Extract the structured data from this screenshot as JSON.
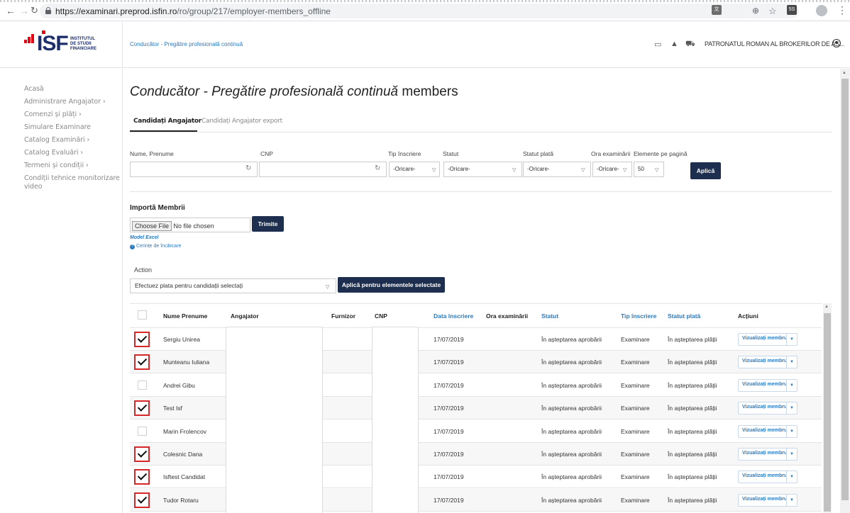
{
  "browser": {
    "url_host": "https://examinari.preprod.isfin.ro",
    "url_path": "/ro/group/217/employer-members_offline"
  },
  "logo": {
    "mark": "ISF",
    "line1": "INSTITUTUL",
    "line2": "DE STUDII",
    "line3": "FINANCIARE"
  },
  "header": {
    "breadcrumb": "Conducător - Pregătire profesională continuă",
    "user": "PATRONATUL ROMAN AL BROKERILOR DE AS..."
  },
  "sidebar": {
    "items": [
      {
        "label": "Acasă"
      },
      {
        "label": "Administrare Angajator ›"
      },
      {
        "label": "Comenzi și plăți ›"
      },
      {
        "label": "Simulare Examinare"
      },
      {
        "label": "Catalog Examinări ›"
      },
      {
        "label": "Catalog Evaluări ›"
      },
      {
        "label": "Termeni și condiții ›"
      },
      {
        "label": "Condiții tehnice monitorizare"
      },
      {
        "label": "video"
      }
    ]
  },
  "main": {
    "title_italic": "Conducător - Pregătire profesională continuă",
    "title_plain": " members",
    "tabs": [
      {
        "label": "Candidați Angajator"
      },
      {
        "label": "Candidați Angajator export"
      }
    ]
  },
  "filters": {
    "labels": {
      "name": "Nume, Prenume",
      "cnp": "CNP",
      "tip": "Tip înscriere",
      "statut": "Statut",
      "statut_plata": "Statut plată",
      "ora": "Ora examinării",
      "elemente": "Elemente pe pagină"
    },
    "values": {
      "name": "",
      "cnp": "",
      "tip": "-Oricare-",
      "statut": "-Oricare-",
      "statut_plata": "-Oricare-",
      "ora": "-Oricare-",
      "elemente": "50"
    },
    "apply_label": "Aplică"
  },
  "import": {
    "title": "Importă Membrii",
    "choose_label": "Choose File",
    "file_status": "No file chosen",
    "submit_label": "Trimite",
    "model_link": "Model Excel",
    "requirements_link": "Cerințe de încărcare"
  },
  "action": {
    "label": "Action",
    "selected": "Efectuez plata pentru candidații selectați",
    "apply_label": "Aplică pentru elementele selectate"
  },
  "table": {
    "headers": {
      "nume": "Nume Prenume",
      "angajator": "Angajator",
      "furnizor": "Furnizor",
      "cnp": "CNP",
      "data": "Data înscriere",
      "ora": "Ora examinării",
      "statut": "Statut",
      "tip": "Tip înscriere",
      "statut_plata": "Statut plată",
      "actiuni": "Acțiuni"
    },
    "view_button_label": "Vizualizați membru",
    "rows": [
      {
        "checked": true,
        "name": "Sergiu Unirea",
        "date": "17/07/2019",
        "status": "În așteptarea aprobării",
        "type": "Examinare",
        "payment": "În așteptarea plății"
      },
      {
        "checked": true,
        "name": "Munteanu Iuliana",
        "date": "17/07/2019",
        "status": "În așteptarea aprobării",
        "type": "Examinare",
        "payment": "În așteptarea plății"
      },
      {
        "checked": false,
        "name": "Andrei Gibu",
        "date": "17/07/2019",
        "status": "În așteptarea aprobării",
        "type": "Examinare",
        "payment": "În așteptarea plății"
      },
      {
        "checked": true,
        "name": "Test Isf",
        "date": "17/07/2019",
        "status": "În așteptarea aprobării",
        "type": "Examinare",
        "payment": "În așteptarea plății"
      },
      {
        "checked": false,
        "name": "Marin Frolencov",
        "date": "17/07/2019",
        "status": "În așteptarea aprobării",
        "type": "Examinare",
        "payment": "În așteptarea plății"
      },
      {
        "checked": true,
        "name": "Colesnic Dana",
        "date": "17/07/2019",
        "status": "În așteptarea aprobării",
        "type": "Examinare",
        "payment": "În așteptarea plății"
      },
      {
        "checked": true,
        "name": "Isftest Candidat",
        "date": "17/07/2019",
        "status": "În așteptarea aprobării",
        "type": "Examinare",
        "payment": "În așteptarea plății"
      },
      {
        "checked": true,
        "name": "Tudor Rotaru",
        "date": "17/07/2019",
        "status": "În așteptarea aprobării",
        "type": "Examinare",
        "payment": "În așteptarea plății"
      }
    ]
  },
  "icons": {
    "back": "back-arrow-icon",
    "forward": "forward-arrow-icon",
    "reload": "reload-icon",
    "lock": "lock-icon",
    "calendar": "calendar-icon",
    "bell": "bell-icon",
    "cart": "cart-icon",
    "user": "user-icon"
  },
  "colors": {
    "brand_navy": "#1d2e6b",
    "brand_red": "#e30613",
    "button_dark": "#1d2e4f",
    "link_blue": "#2a7ac0",
    "highlight_red": "#d62828"
  }
}
